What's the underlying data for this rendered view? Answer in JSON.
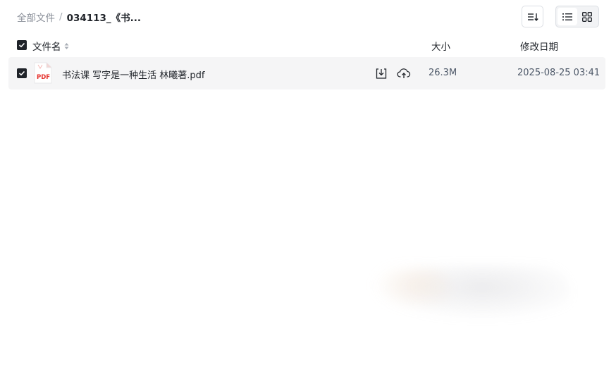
{
  "breadcrumb": {
    "root": "全部文件",
    "separator": "/",
    "current": "034113_《书..."
  },
  "toolbar": {
    "sort_icon": "sort-list-icon",
    "view_modes": [
      "list-view-icon",
      "grid-view-icon"
    ],
    "active_view": "list"
  },
  "table": {
    "header": {
      "name": "文件名",
      "size": "大小",
      "date": "修改日期"
    },
    "rows": [
      {
        "checked": true,
        "icon": "pdf-file-icon",
        "icon_label": "PDF",
        "name": "书法课 写字是一种生活 林曦著.pdf",
        "size": "26.3M",
        "date": "2025-08-25 03:41"
      }
    ]
  },
  "colors": {
    "accent_dark": "#1f2329",
    "row_bg": "#f5f5f6",
    "pdf_red": "#e5322d"
  }
}
